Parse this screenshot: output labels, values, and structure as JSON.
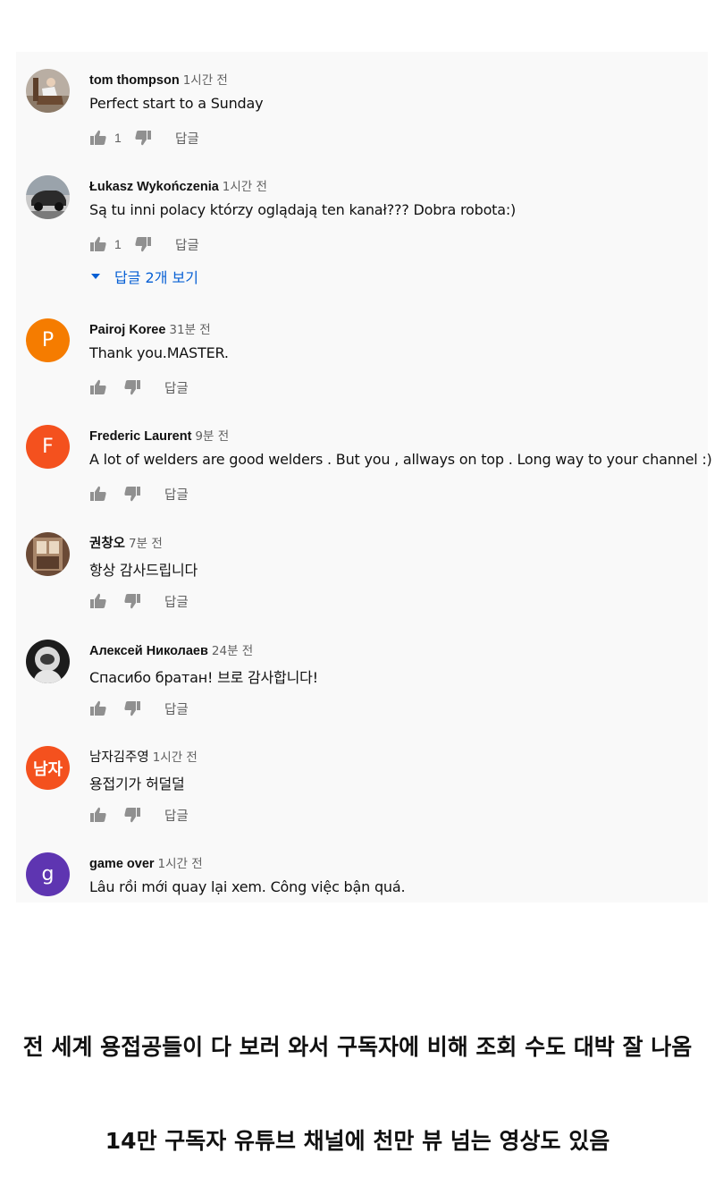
{
  "comments": [
    {
      "author": "tom thompson",
      "time": "1시간 전",
      "text": "Perfect start to a Sunday",
      "likes": "1",
      "reply_label": "답글",
      "avatar": {
        "type": "photo",
        "icon": "person-rocking-chair-photo"
      }
    },
    {
      "author": "Łukasz Wykończenia",
      "time": "1시간 전",
      "text": "Są tu inni polacy którzy oglądają ten kanał??? Dobra robota:)",
      "likes": "1",
      "reply_label": "답글",
      "avatar": {
        "type": "photo",
        "icon": "car-photo"
      },
      "view_replies": "답글 2개 보기"
    },
    {
      "author": "Pairoj Koree",
      "time": "31분 전",
      "text": "Thank you.MASTER.",
      "likes": "",
      "reply_label": "답글",
      "avatar": {
        "type": "letter",
        "letter": "P",
        "color": "#f57c00"
      }
    },
    {
      "author": "Frederic Laurent",
      "time": "9분 전",
      "text": "A lot of welders are good welders . But you , allways on top . Long way to your channel :)",
      "likes": "",
      "reply_label": "답글",
      "avatar": {
        "type": "letter",
        "letter": "F",
        "color": "#f4511e"
      }
    },
    {
      "author": "권창오",
      "time": "7분 전",
      "text": "항상 감사드립니다",
      "likes": "",
      "reply_label": "답글",
      "avatar": {
        "type": "photo",
        "icon": "room-photo"
      }
    },
    {
      "author": "Алексей Николаев",
      "time": "24분 전",
      "text": "Спасибо братан! 브로 감사합니다!",
      "likes": "",
      "reply_label": "답글",
      "avatar": {
        "type": "photo",
        "icon": "astronaut-photo"
      }
    },
    {
      "author": "남자김주영",
      "time": "1시간 전",
      "text": "용접기가  허덜덜",
      "likes": "",
      "reply_label": "답글",
      "avatar": {
        "type": "letter",
        "letter": "남자",
        "color": "#f4511e"
      }
    },
    {
      "author": "game over",
      "time": "1시간 전",
      "text": "Lâu rồi mới quay lại xem. Công việc bận quá.",
      "likes": "",
      "reply_label": "",
      "avatar": {
        "type": "letter",
        "letter": "g",
        "color": "#5e35b1"
      }
    }
  ],
  "captions": [
    "전 세계 용접공들이 다 보러 와서 구독자에 비해 조회 수도 대박 잘 나옴",
    "14만 구독자 유튜브 채널에 천만 뷰 넘는 영상도 있음"
  ],
  "colors": {
    "link": "#065fd4",
    "panel_bg": "#f9f9f9",
    "secondary_text": "#606060"
  }
}
